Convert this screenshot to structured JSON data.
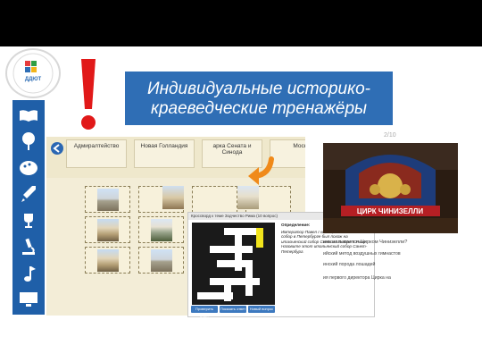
{
  "header": {
    "title": "Индивидуальные историко-краеведческие тренажёры",
    "exclamation": "!",
    "small_tag": "2/10"
  },
  "logo": {
    "center_text": "ДДЮТ"
  },
  "sidebar": {
    "icons": [
      "book-icon",
      "tree-icon",
      "palette-icon",
      "rocket-icon",
      "trophy-icon",
      "microscope-icon",
      "music-note-icon",
      "computer-icon"
    ]
  },
  "matching_app": {
    "chips": [
      "Адмиралтейство",
      "Новая Голландия",
      "арка Сената и Синода",
      "Моск"
    ]
  },
  "crossword": {
    "header": "Кроссворд к теме Зодчество Рима (10 вопрос)",
    "heading": "Определение:",
    "body": "Император Павел I хотел, чтобы этот собор в Петербурге был похож на итальянский собор Святого Петра в Риме. Назовите этот итальянский собор Санкт-Петербург.",
    "buttons": [
      "Проверить ответ",
      "Показать ответ",
      "Новый вопрос"
    ]
  },
  "quiz_side": {
    "photo_sign": "ЦИРК ЧИНИЗЕЛЛИ",
    "lines": [
      "ник называется Цирком Чинизелли?",
      "",
      "ийский метод воздушных гимнастов",
      "инский порода лошадей",
      "",
      "ия первого директора Цирка на"
    ]
  },
  "colors": {
    "accent": "#2f6eb5",
    "sidebar": "#1f5fa8",
    "exclaim": "#e11919"
  }
}
